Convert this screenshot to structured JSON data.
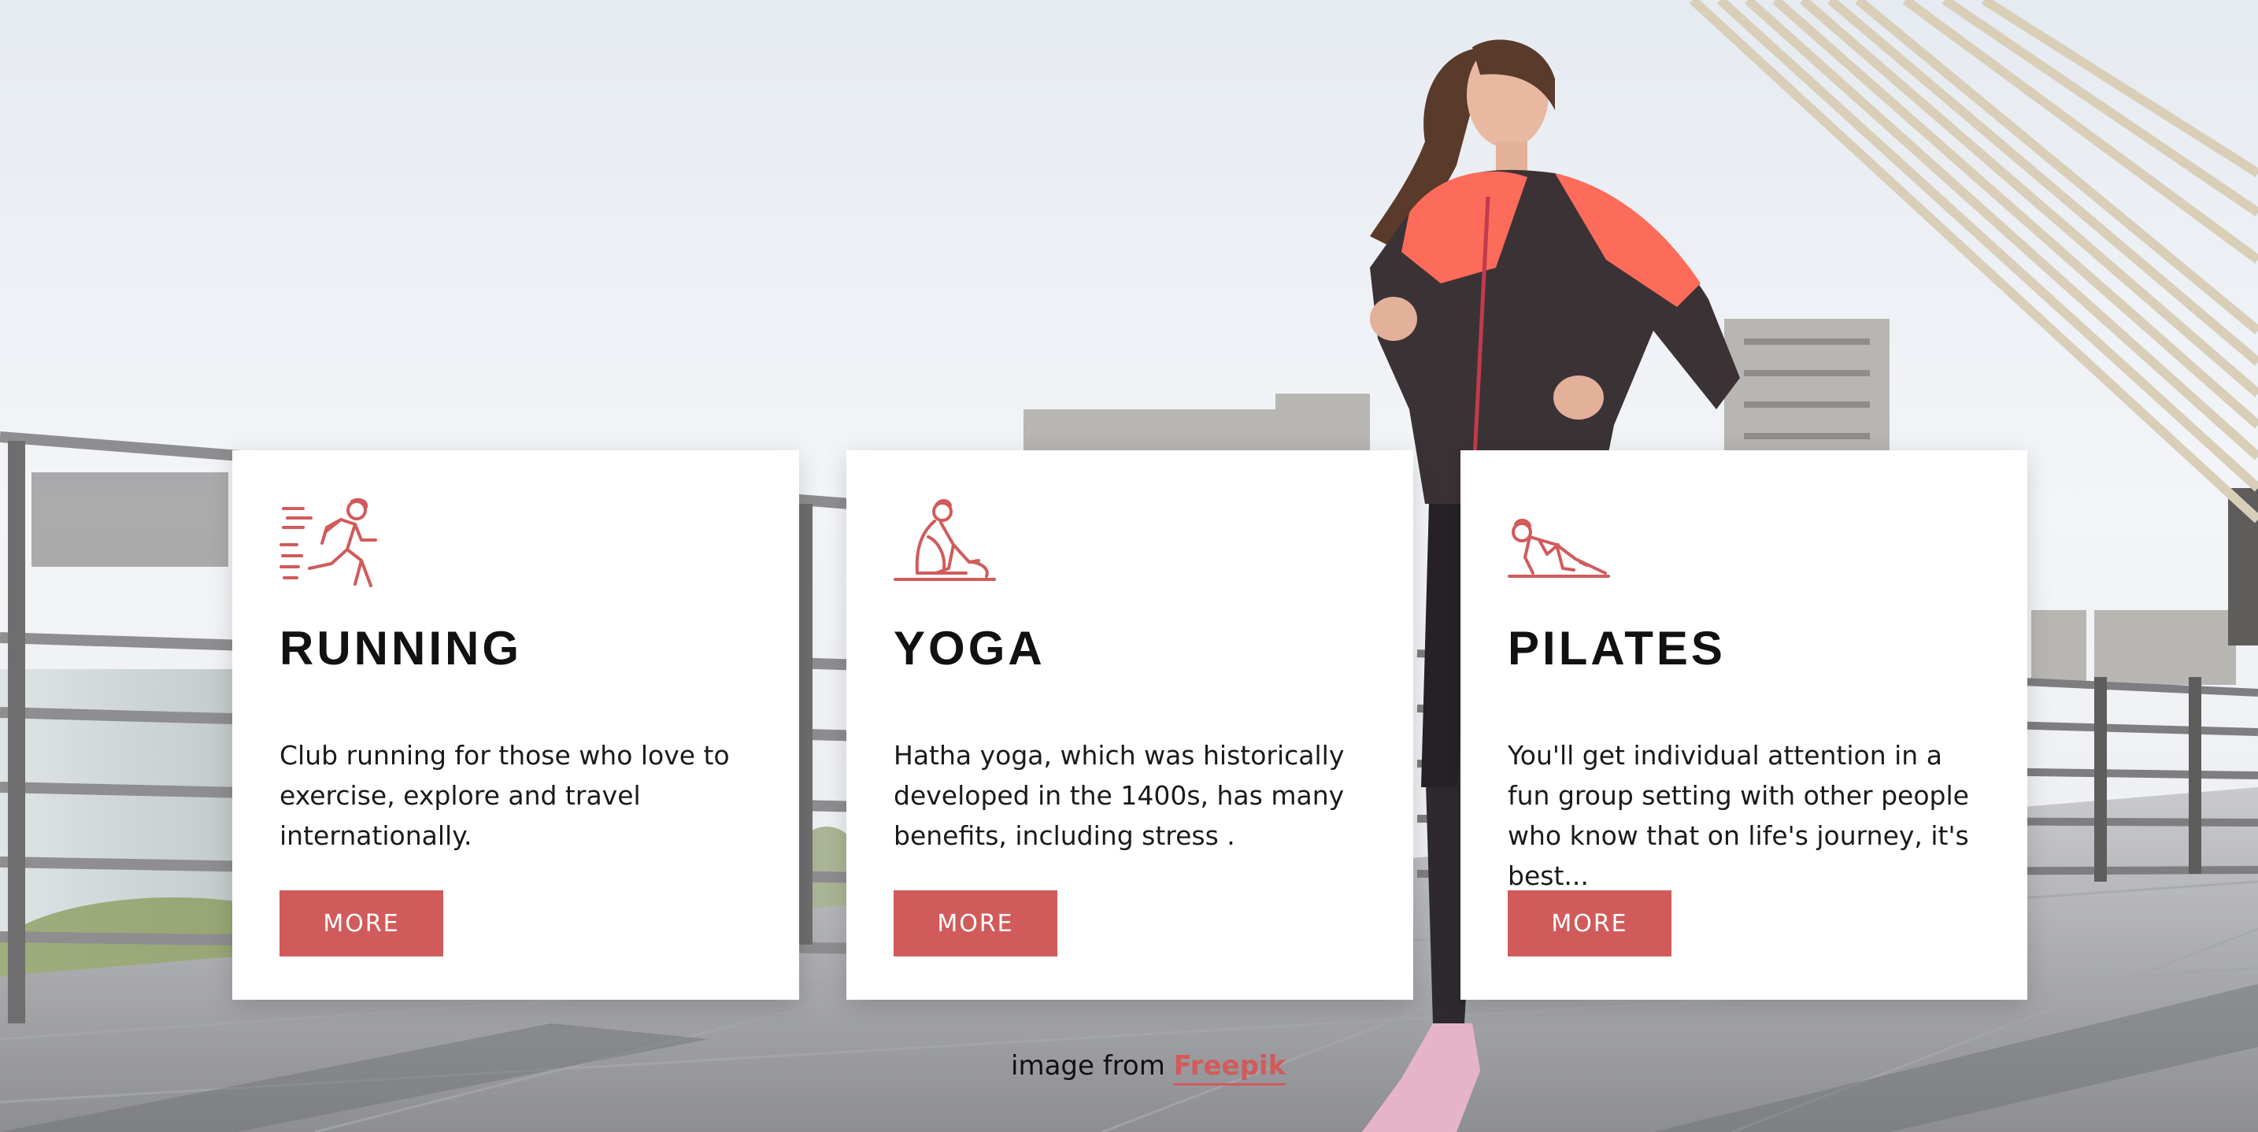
{
  "colors": {
    "accent": "#d15b5b",
    "card_background": "#ffffff",
    "title": "#111111",
    "text": "#1a1a1a"
  },
  "cards": [
    {
      "icon": "running-person-icon",
      "title": "RUNNING",
      "description": "Club running for those who love to exercise, explore and travel internationally.",
      "button_label": "MORE"
    },
    {
      "icon": "yoga-pose-icon",
      "title": "YOGA",
      "description": "Hatha yoga, which was historically developed in the 1400s, has many benefits, including stress .",
      "button_label": "MORE"
    },
    {
      "icon": "pilates-plank-icon",
      "title": "PILATES",
      "description": "You'll get individual attention in a fun group setting with other people who know that on life's journey, it's best...",
      "button_label": "MORE"
    }
  ],
  "credit": {
    "prefix": "image from",
    "link_label": "Freepik"
  }
}
